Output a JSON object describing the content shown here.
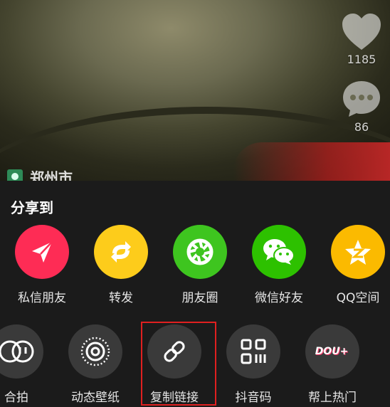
{
  "video": {
    "like_count": "1185",
    "comment_count": "86",
    "location_text": "郑州市"
  },
  "share_sheet": {
    "title": "分享到",
    "row1": [
      {
        "label": "私信朋友",
        "icon": "paper-plane-icon",
        "color": "#fe2c55"
      },
      {
        "label": "转发",
        "icon": "repost-arrows-icon",
        "color": "#fdcc1b"
      },
      {
        "label": "朋友圈",
        "icon": "wechat-moments-icon",
        "color": "#3ec51f"
      },
      {
        "label": "微信好友",
        "icon": "wechat-icon",
        "color": "#2dc100"
      },
      {
        "label": "QQ空间",
        "icon": "qzone-star-icon",
        "color": "#fbba00"
      }
    ],
    "row2": [
      {
        "label": "合拍",
        "icon": "duet-icon"
      },
      {
        "label": "动态壁纸",
        "icon": "live-wallpaper-icon"
      },
      {
        "label": "复制链接",
        "icon": "link-icon"
      },
      {
        "label": "抖音码",
        "icon": "qr-code-icon"
      },
      {
        "label": "帮上热门",
        "icon": "dou-plus-icon",
        "badge_text": "DOU+"
      }
    ]
  },
  "colors": {
    "sheet_background": "#1b1b1b",
    "dark_tile": "#3a3a3a",
    "highlight_border": "#e02020"
  }
}
